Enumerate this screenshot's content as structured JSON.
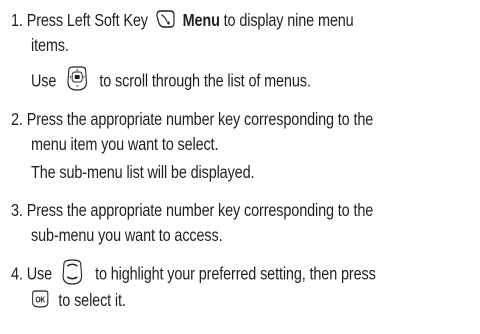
{
  "steps": [
    {
      "number": "1.",
      "part1": "Press Left Soft Key",
      "menu_word": "Menu",
      "part2": "to display nine menu",
      "line2": "items.",
      "sub_use": "Use",
      "sub_rest": "to scroll through the list of menus."
    },
    {
      "number": "2.",
      "line1": "Press the appropriate number key corresponding to the",
      "line2": "menu item you want to select.",
      "sub": "The sub-menu list will be displayed."
    },
    {
      "number": "3.",
      "line1": "Press the appropriate number key corresponding to the",
      "line2": "sub-menu you want to access."
    },
    {
      "number": "4.",
      "use": "Use",
      "rest": "to highlight your preferred setting, then press",
      "line2_rest": "to select it."
    }
  ],
  "icons": {
    "soft_key": "left-soft-key-icon",
    "nav_key": "navigation-key-icon",
    "up_down_key": "up-down-navigation-icon",
    "ok_key": "ok-key-icon",
    "ok_label": "OK"
  }
}
